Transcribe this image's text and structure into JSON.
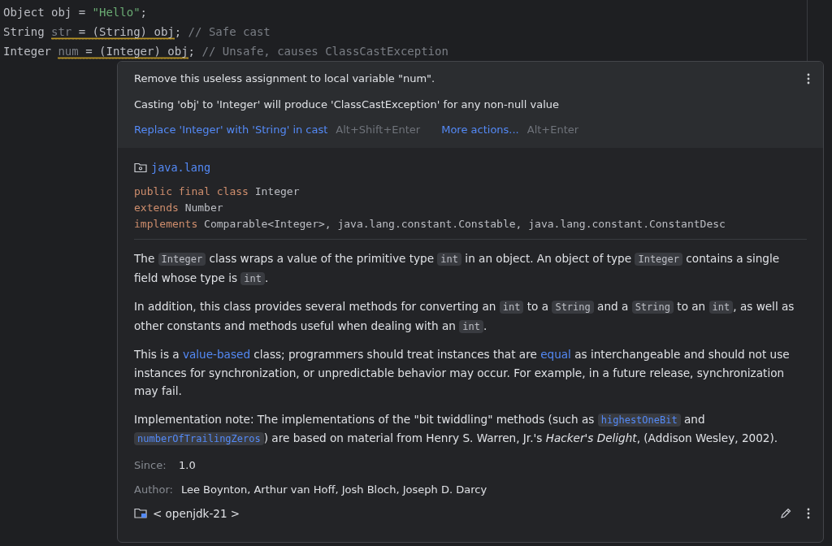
{
  "editor": {
    "lines": [
      [
        {
          "kind": "plain",
          "text": "Object obj = ",
          "underlined": false
        },
        {
          "kind": "string",
          "text": "\"Hello\"",
          "underlined": false
        },
        {
          "kind": "plain",
          "text": ";",
          "underlined": false
        }
      ],
      [
        {
          "kind": "plain",
          "text": "String ",
          "underlined": false
        },
        {
          "kind": "unused",
          "text": "str",
          "underlined": true
        },
        {
          "kind": "plain",
          "text": " = (String) obj",
          "underlined": true
        },
        {
          "kind": "plain",
          "text": "; ",
          "underlined": false
        },
        {
          "kind": "comment",
          "text": "// Safe cast",
          "underlined": false
        }
      ],
      [
        {
          "kind": "plain",
          "text": "Integer ",
          "underlined": false
        },
        {
          "kind": "unused",
          "text": "num",
          "underlined": true
        },
        {
          "kind": "plain",
          "text": " = (Integer) obj",
          "underlined": true
        },
        {
          "kind": "plain",
          "text": "; ",
          "underlined": false
        },
        {
          "kind": "comment",
          "text": "// Unsafe, causes ClassCastException",
          "underlined": false
        }
      ]
    ]
  },
  "popup": {
    "problems": [
      "Remove this useless assignment to local variable \"num\".",
      "Casting 'obj' to 'Integer' will produce 'ClassCastException' for any non-null value"
    ],
    "actions": [
      {
        "label": "Replace 'Integer' with 'String' in cast",
        "shortcut": "Alt+Shift+Enter"
      },
      {
        "label": "More actions...",
        "shortcut": "Alt+Enter"
      }
    ],
    "package": "java.lang",
    "signature": [
      [
        {
          "kind": "keyword",
          "text": "public final class "
        },
        {
          "kind": "plain",
          "text": "Integer"
        }
      ],
      [
        {
          "kind": "keyword",
          "text": "extends "
        },
        {
          "kind": "plain",
          "text": "Number"
        }
      ],
      [
        {
          "kind": "keyword",
          "text": "implements "
        },
        {
          "kind": "plain",
          "text": "Comparable<Integer>, java.lang.constant.Constable, java.lang.constant.ConstantDesc"
        }
      ]
    ],
    "paragraphs": [
      [
        {
          "kind": "text",
          "text": "The "
        },
        {
          "kind": "code",
          "text": "Integer"
        },
        {
          "kind": "text",
          "text": " class wraps a value of the primitive type "
        },
        {
          "kind": "code",
          "text": "int"
        },
        {
          "kind": "text",
          "text": " in an object. An object of type "
        },
        {
          "kind": "code",
          "text": "Integer"
        },
        {
          "kind": "text",
          "text": " contains a single field whose type is "
        },
        {
          "kind": "code",
          "text": "int"
        },
        {
          "kind": "text",
          "text": "."
        }
      ],
      [
        {
          "kind": "text",
          "text": "In addition, this class provides several methods for converting an "
        },
        {
          "kind": "code",
          "text": "int"
        },
        {
          "kind": "text",
          "text": " to a "
        },
        {
          "kind": "code",
          "text": "String"
        },
        {
          "kind": "text",
          "text": " and a "
        },
        {
          "kind": "code",
          "text": "String"
        },
        {
          "kind": "text",
          "text": " to an "
        },
        {
          "kind": "code",
          "text": "int"
        },
        {
          "kind": "text",
          "text": ", as well as other constants and methods useful when dealing with an "
        },
        {
          "kind": "code",
          "text": "int"
        },
        {
          "kind": "text",
          "text": "."
        }
      ],
      [
        {
          "kind": "text",
          "text": "This is a "
        },
        {
          "kind": "link",
          "text": "value-based"
        },
        {
          "kind": "text",
          "text": " class; programmers should treat instances that are "
        },
        {
          "kind": "link",
          "text": "equal"
        },
        {
          "kind": "text",
          "text": " as interchangeable and should not use instances for synchronization, or unpredictable behavior may occur. For example, in a future release, synchronization may fail."
        }
      ],
      [
        {
          "kind": "text",
          "text": "Implementation note: The implementations of the \"bit twiddling\" methods (such as "
        },
        {
          "kind": "codelink",
          "text": "highestOneBit"
        },
        {
          "kind": "text",
          "text": " and "
        },
        {
          "kind": "codelink",
          "text": "numberOfTrailingZeros"
        },
        {
          "kind": "text",
          "text": ") are based on material from Henry S. Warren, Jr.'s *Hacker's Delight*, (Addison Wesley, 2002)."
        }
      ]
    ],
    "fields": [
      {
        "label": "Since:",
        "value": "1.0"
      },
      {
        "label": "Author:",
        "value": "Lee Boynton, Arthur van Hoff, Josh Bloch, Joseph D. Darcy"
      }
    ],
    "library": "< openjdk-21 >"
  }
}
